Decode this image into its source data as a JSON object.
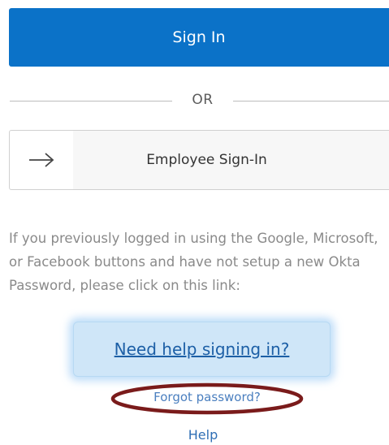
{
  "signin_button": {
    "label": "Sign In"
  },
  "divider": {
    "text": "OR"
  },
  "employee_button": {
    "label": "Employee Sign-In",
    "icon": "arrow-right-icon"
  },
  "info": {
    "text": "If you previously logged in using the Google, Microsoft, or Facebook buttons and have not setup a new Okta Password, please click on this link:"
  },
  "help_signin": {
    "label": "Need help signing in?"
  },
  "forgot": {
    "label": "Forgot password?"
  },
  "help": {
    "label": "Help"
  },
  "colors": {
    "primary_button": "#0b72c8",
    "link": "#1c5fa6",
    "highlight_box": "#cfe6f8",
    "annotation_ellipse": "#7a1b1b"
  }
}
